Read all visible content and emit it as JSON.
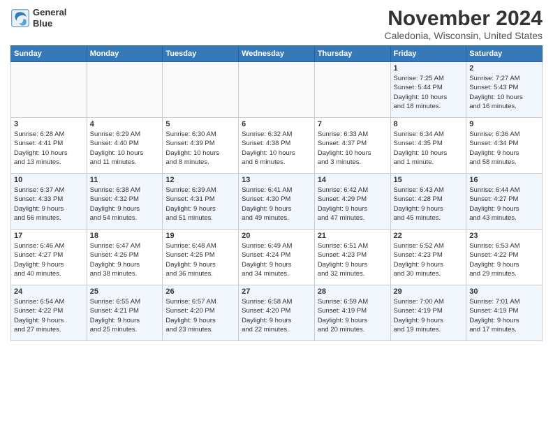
{
  "header": {
    "logo_line1": "General",
    "logo_line2": "Blue",
    "month": "November 2024",
    "location": "Caledonia, Wisconsin, United States"
  },
  "weekdays": [
    "Sunday",
    "Monday",
    "Tuesday",
    "Wednesday",
    "Thursday",
    "Friday",
    "Saturday"
  ],
  "weeks": [
    [
      {
        "day": "",
        "info": ""
      },
      {
        "day": "",
        "info": ""
      },
      {
        "day": "",
        "info": ""
      },
      {
        "day": "",
        "info": ""
      },
      {
        "day": "",
        "info": ""
      },
      {
        "day": "1",
        "info": "Sunrise: 7:25 AM\nSunset: 5:44 PM\nDaylight: 10 hours\nand 18 minutes."
      },
      {
        "day": "2",
        "info": "Sunrise: 7:27 AM\nSunset: 5:43 PM\nDaylight: 10 hours\nand 16 minutes."
      }
    ],
    [
      {
        "day": "3",
        "info": "Sunrise: 6:28 AM\nSunset: 4:41 PM\nDaylight: 10 hours\nand 13 minutes."
      },
      {
        "day": "4",
        "info": "Sunrise: 6:29 AM\nSunset: 4:40 PM\nDaylight: 10 hours\nand 11 minutes."
      },
      {
        "day": "5",
        "info": "Sunrise: 6:30 AM\nSunset: 4:39 PM\nDaylight: 10 hours\nand 8 minutes."
      },
      {
        "day": "6",
        "info": "Sunrise: 6:32 AM\nSunset: 4:38 PM\nDaylight: 10 hours\nand 6 minutes."
      },
      {
        "day": "7",
        "info": "Sunrise: 6:33 AM\nSunset: 4:37 PM\nDaylight: 10 hours\nand 3 minutes."
      },
      {
        "day": "8",
        "info": "Sunrise: 6:34 AM\nSunset: 4:35 PM\nDaylight: 10 hours\nand 1 minute."
      },
      {
        "day": "9",
        "info": "Sunrise: 6:36 AM\nSunset: 4:34 PM\nDaylight: 9 hours\nand 58 minutes."
      }
    ],
    [
      {
        "day": "10",
        "info": "Sunrise: 6:37 AM\nSunset: 4:33 PM\nDaylight: 9 hours\nand 56 minutes."
      },
      {
        "day": "11",
        "info": "Sunrise: 6:38 AM\nSunset: 4:32 PM\nDaylight: 9 hours\nand 54 minutes."
      },
      {
        "day": "12",
        "info": "Sunrise: 6:39 AM\nSunset: 4:31 PM\nDaylight: 9 hours\nand 51 minutes."
      },
      {
        "day": "13",
        "info": "Sunrise: 6:41 AM\nSunset: 4:30 PM\nDaylight: 9 hours\nand 49 minutes."
      },
      {
        "day": "14",
        "info": "Sunrise: 6:42 AM\nSunset: 4:29 PM\nDaylight: 9 hours\nand 47 minutes."
      },
      {
        "day": "15",
        "info": "Sunrise: 6:43 AM\nSunset: 4:28 PM\nDaylight: 9 hours\nand 45 minutes."
      },
      {
        "day": "16",
        "info": "Sunrise: 6:44 AM\nSunset: 4:27 PM\nDaylight: 9 hours\nand 43 minutes."
      }
    ],
    [
      {
        "day": "17",
        "info": "Sunrise: 6:46 AM\nSunset: 4:27 PM\nDaylight: 9 hours\nand 40 minutes."
      },
      {
        "day": "18",
        "info": "Sunrise: 6:47 AM\nSunset: 4:26 PM\nDaylight: 9 hours\nand 38 minutes."
      },
      {
        "day": "19",
        "info": "Sunrise: 6:48 AM\nSunset: 4:25 PM\nDaylight: 9 hours\nand 36 minutes."
      },
      {
        "day": "20",
        "info": "Sunrise: 6:49 AM\nSunset: 4:24 PM\nDaylight: 9 hours\nand 34 minutes."
      },
      {
        "day": "21",
        "info": "Sunrise: 6:51 AM\nSunset: 4:23 PM\nDaylight: 9 hours\nand 32 minutes."
      },
      {
        "day": "22",
        "info": "Sunrise: 6:52 AM\nSunset: 4:23 PM\nDaylight: 9 hours\nand 30 minutes."
      },
      {
        "day": "23",
        "info": "Sunrise: 6:53 AM\nSunset: 4:22 PM\nDaylight: 9 hours\nand 29 minutes."
      }
    ],
    [
      {
        "day": "24",
        "info": "Sunrise: 6:54 AM\nSunset: 4:22 PM\nDaylight: 9 hours\nand 27 minutes."
      },
      {
        "day": "25",
        "info": "Sunrise: 6:55 AM\nSunset: 4:21 PM\nDaylight: 9 hours\nand 25 minutes."
      },
      {
        "day": "26",
        "info": "Sunrise: 6:57 AM\nSunset: 4:20 PM\nDaylight: 9 hours\nand 23 minutes."
      },
      {
        "day": "27",
        "info": "Sunrise: 6:58 AM\nSunset: 4:20 PM\nDaylight: 9 hours\nand 22 minutes."
      },
      {
        "day": "28",
        "info": "Sunrise: 6:59 AM\nSunset: 4:19 PM\nDaylight: 9 hours\nand 20 minutes."
      },
      {
        "day": "29",
        "info": "Sunrise: 7:00 AM\nSunset: 4:19 PM\nDaylight: 9 hours\nand 19 minutes."
      },
      {
        "day": "30",
        "info": "Sunrise: 7:01 AM\nSunset: 4:19 PM\nDaylight: 9 hours\nand 17 minutes."
      }
    ]
  ]
}
